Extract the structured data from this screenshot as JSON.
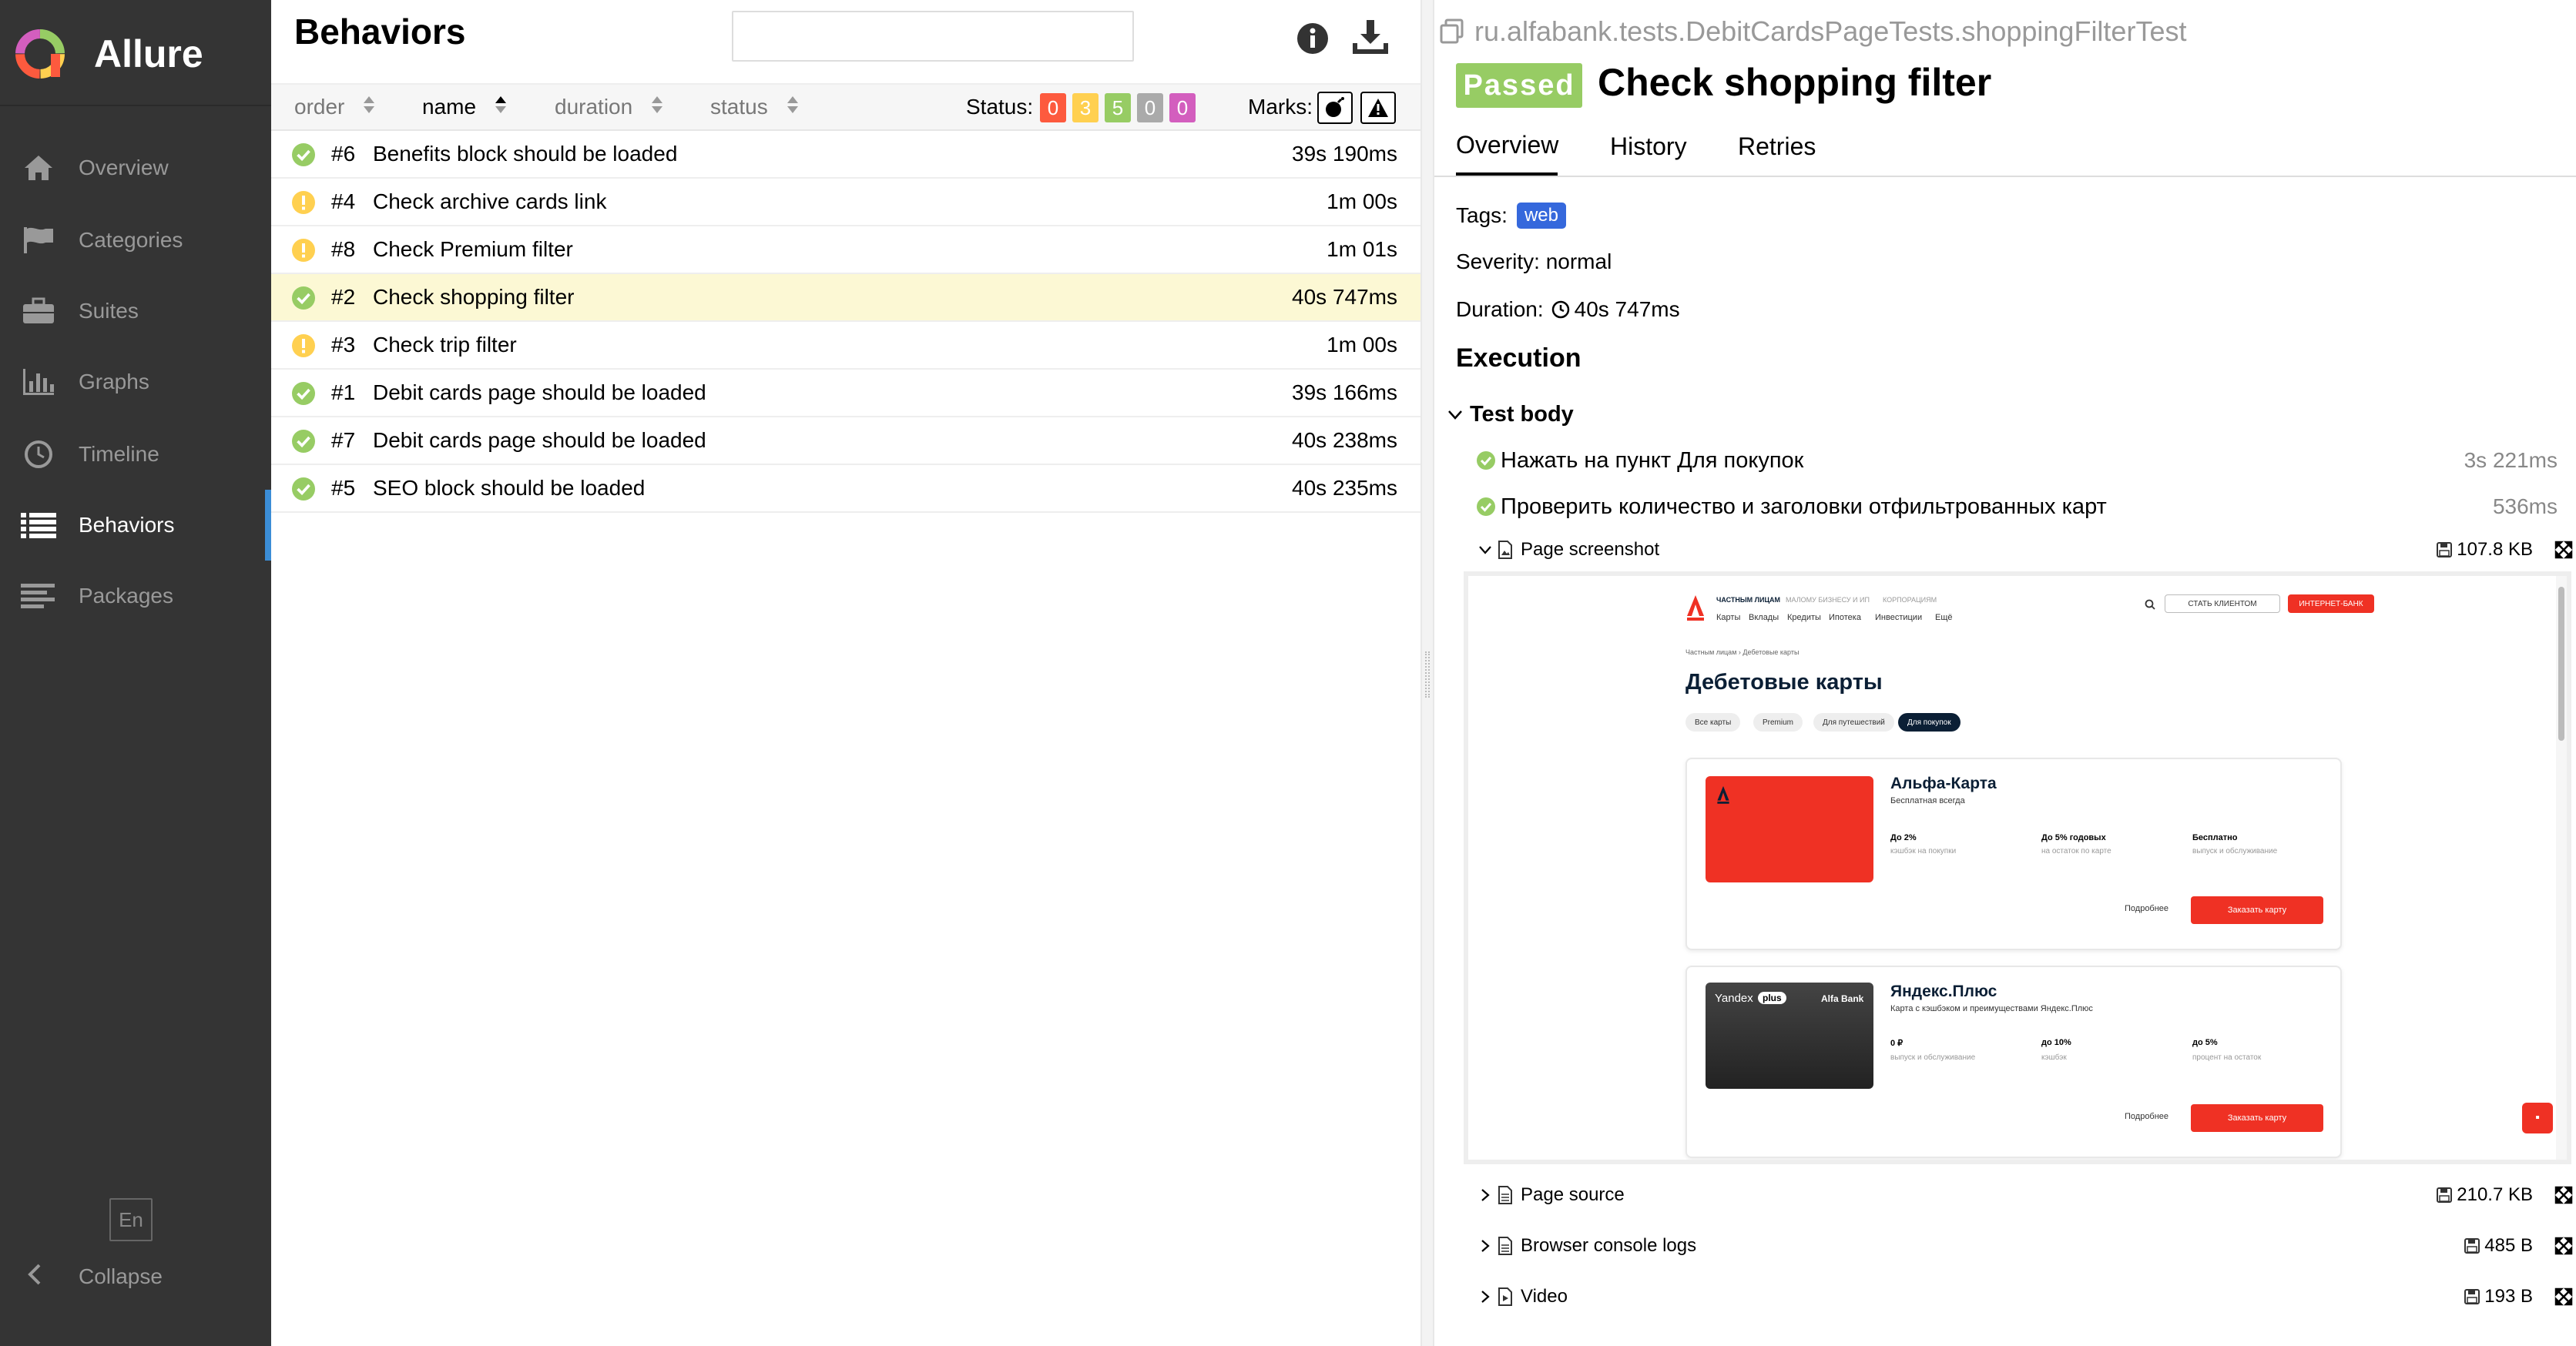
{
  "app": {
    "name": "Allure"
  },
  "sidebar": {
    "items": [
      {
        "label": "Overview",
        "icon": "home-icon"
      },
      {
        "label": "Categories",
        "icon": "flag-icon"
      },
      {
        "label": "Suites",
        "icon": "briefcase-icon"
      },
      {
        "label": "Graphs",
        "icon": "bar-chart-icon"
      },
      {
        "label": "Timeline",
        "icon": "clock-icon"
      },
      {
        "label": "Behaviors",
        "icon": "list-icon",
        "active": true
      },
      {
        "label": "Packages",
        "icon": "align-left-icon"
      }
    ],
    "language": "En",
    "collapse_label": "Collapse"
  },
  "list": {
    "title": "Behaviors",
    "search_placeholder": "",
    "columns": {
      "order": "order",
      "name": "name",
      "duration": "duration",
      "status": "status"
    },
    "status_label": "Status:",
    "status_counts": [
      {
        "value": "0",
        "color": "#fd5a3e"
      },
      {
        "value": "3",
        "color": "#ffd050"
      },
      {
        "value": "5",
        "color": "#97cc64"
      },
      {
        "value": "0",
        "color": "#aaaaaa"
      },
      {
        "value": "0",
        "color": "#d35ebe"
      }
    ],
    "marks_label": "Marks:",
    "rows": [
      {
        "order": "#6",
        "name": "Benefits block should be loaded",
        "duration": "39s 190ms",
        "status": "passed"
      },
      {
        "order": "#4",
        "name": "Check archive cards link",
        "duration": "1m 00s",
        "status": "broken"
      },
      {
        "order": "#8",
        "name": "Check Premium filter",
        "duration": "1m 01s",
        "status": "broken"
      },
      {
        "order": "#2",
        "name": "Check shopping filter",
        "duration": "40s 747ms",
        "status": "passed",
        "selected": true
      },
      {
        "order": "#3",
        "name": "Check trip filter",
        "duration": "1m 00s",
        "status": "broken"
      },
      {
        "order": "#1",
        "name": "Debit cards page should be loaded",
        "duration": "39s 166ms",
        "status": "passed"
      },
      {
        "order": "#7",
        "name": "Debit cards page should be loaded",
        "duration": "40s 238ms",
        "status": "passed"
      },
      {
        "order": "#5",
        "name": "SEO block should be loaded",
        "duration": "40s 235ms",
        "status": "passed"
      }
    ]
  },
  "detail": {
    "full_name": "ru.alfabank.tests.DebitCardsPageTests.shoppingFilterTest",
    "status_badge": "Passed",
    "title": "Check shopping filter",
    "tabs": [
      "Overview",
      "History",
      "Retries"
    ],
    "tags_label": "Tags:",
    "tag": "web",
    "severity": "Severity: normal",
    "duration_label": "Duration:",
    "duration": "40s 747ms",
    "execution_title": "Execution",
    "test_body_label": "Test body",
    "steps": [
      {
        "name": "Нажать на пункт Для покупок",
        "duration": "3s 221ms"
      },
      {
        "name": "Проверить количество и заголовки отфильтрованных карт",
        "duration": "536ms"
      }
    ],
    "attachments": [
      {
        "name": "Page screenshot",
        "size": "107.8 KB",
        "expanded": true
      },
      {
        "name": "Page source",
        "size": "210.7 KB"
      },
      {
        "name": "Browser console logs",
        "size": "485 B"
      },
      {
        "name": "Video",
        "size": "193 B"
      }
    ]
  },
  "screenshot": {
    "nav_top": [
      "ЧАСТНЫМ ЛИЦАМ",
      "МАЛОМУ БИЗНЕСУ И ИП",
      "КОРПОРАЦИЯМ"
    ],
    "nav_sub": [
      "Карты",
      "Вклады",
      "Кредиты",
      "Ипотека",
      "Инвестиции",
      "Ещё"
    ],
    "become_client": "СТАТЬ КЛИЕНТОМ",
    "internet_bank": "ИНТЕРНЕТ-БАНК",
    "breadcrumb": "Частным лицам  ›  Дебетовые карты",
    "page_title": "Дебетовые карты",
    "chips": [
      "Все карты",
      "Premium",
      "Для путешествий",
      "Для покупок"
    ],
    "cards": [
      {
        "name": "Альфа-Карта",
        "subtitle": "Бесплатная всегда",
        "features": [
          {
            "value": "До 2%",
            "desc": "кэшбэк на покупки"
          },
          {
            "value": "До 5% годовых",
            "desc": "на остаток по карте"
          },
          {
            "value": "Бесплатно",
            "desc": "выпуск и обслуживание"
          }
        ],
        "more": "Подробнее",
        "order": "Заказать карту"
      },
      {
        "name": "Яндекс.Плюс",
        "subtitle": "Карта с кэшбэком и преимуществами Яндекс.Плюс",
        "features": [
          {
            "value": "0 ₽",
            "desc": "выпуск и обслуживание"
          },
          {
            "value": "до 10%",
            "desc": "кэшбэк"
          },
          {
            "value": "до 5%",
            "desc": "процент на остаток"
          }
        ],
        "more": "Подробнее",
        "order": "Заказать карту",
        "card_text_left": "Yandex",
        "card_text_plus": "plus",
        "card_text_right": "Alfa Bank"
      }
    ]
  }
}
